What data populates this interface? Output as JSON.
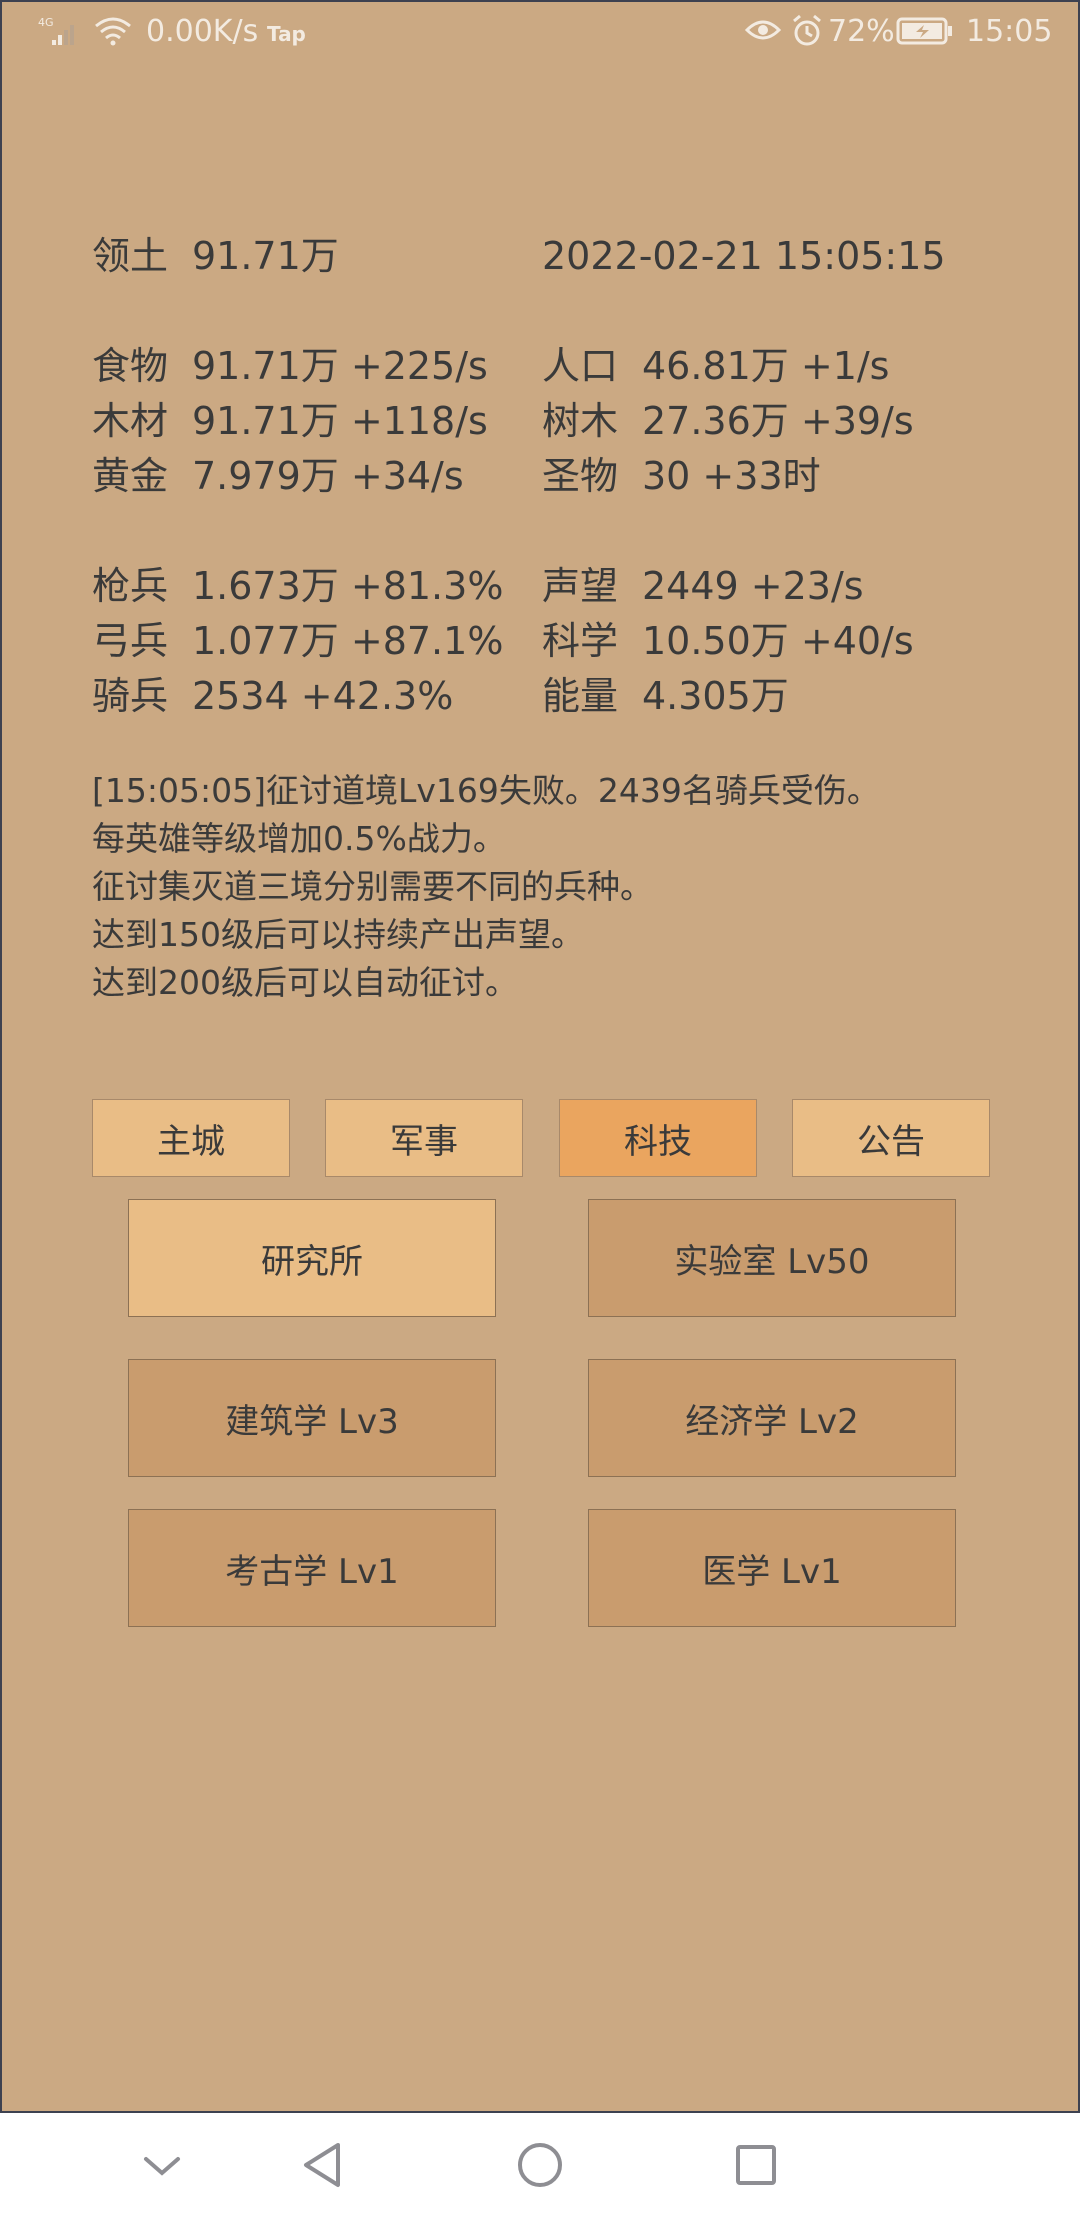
{
  "status_bar": {
    "signal": "4G",
    "net_speed": "0.00K/s",
    "tap_label": "Tap",
    "battery_pct": "72%",
    "time": "15:05"
  },
  "header": {
    "territory_label": "领土",
    "territory_value": "91.71万",
    "datetime": "2022-02-21 15:05:15"
  },
  "resources_left": [
    {
      "label": "食物",
      "value": "91.71万 +225/s"
    },
    {
      "label": "木材",
      "value": "91.71万 +118/s"
    },
    {
      "label": "黄金",
      "value": "7.979万 +34/s"
    }
  ],
  "resources_right": [
    {
      "label": "人口",
      "value": "46.81万 +1/s"
    },
    {
      "label": "树木",
      "value": "27.36万 +39/s"
    },
    {
      "label": "圣物",
      "value": "30 +33时"
    }
  ],
  "troops_left": [
    {
      "label": "枪兵",
      "value": "1.673万 +81.3%"
    },
    {
      "label": "弓兵",
      "value": "1.077万 +87.1%"
    },
    {
      "label": "骑兵",
      "value": "2534 +42.3%"
    }
  ],
  "troops_right": [
    {
      "label": "声望",
      "value": "2449 +23/s"
    },
    {
      "label": "科学",
      "value": "10.50万 +40/s"
    },
    {
      "label": "能量",
      "value": "4.305万"
    }
  ],
  "log": [
    "[15:05:05]征讨道境Lv169失败。2439名骑兵受伤。",
    "每英雄等级增加0.5%战力。",
    "征讨集灭道三境分别需要不同的兵种。",
    "达到150级后可以持续产出声望。",
    "达到200级后可以自动征讨。"
  ],
  "tabs": [
    "主城",
    "军事",
    "科技",
    "公告"
  ],
  "active_tab": "科技",
  "tech_buttons": [
    {
      "label": "研究所"
    },
    {
      "label": "实验室 Lv50"
    },
    {
      "label": "建筑学 Lv3"
    },
    {
      "label": "经济学 Lv2"
    },
    {
      "label": "考古学 Lv1"
    },
    {
      "label": "医学 Lv1"
    }
  ],
  "colors": {
    "background": "#cba983",
    "tab": "#e9bd86",
    "tab_active": "#eaa55f",
    "button": "#c99c6e"
  }
}
